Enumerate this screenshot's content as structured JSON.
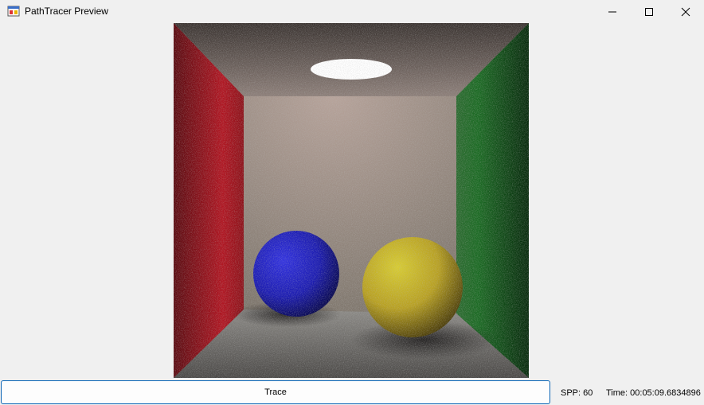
{
  "window": {
    "title": "PathTracer Preview",
    "icon": "app-window-icon",
    "controls": [
      "minimize-icon",
      "maximize-icon",
      "close-icon"
    ]
  },
  "viewport": {
    "description_icon": "rendered-scene-image"
  },
  "toolbar": {
    "trace_label": "Trace",
    "spp_label": "SPP: 60",
    "time_label": "Time: 00:05:09.6834896",
    "accent": "#0a64b4"
  }
}
